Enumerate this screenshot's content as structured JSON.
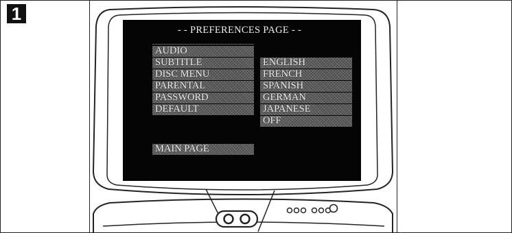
{
  "step": {
    "number": "1"
  },
  "screen": {
    "title": "- - PREFERENCES PAGE - -",
    "menu_items": [
      "AUDIO",
      "SUBTITLE",
      "DISC MENU",
      "PARENTAL",
      "PASSWORD",
      "DEFAULT"
    ],
    "options": [
      "ENGLISH",
      "FRENCH",
      "SPANISH",
      "GERMAN",
      "JAPANESE",
      "OFF"
    ],
    "main_page_label": "MAIN PAGE"
  },
  "colors": {
    "screen_background": "#050505",
    "menu_highlight": "#5a5a5a",
    "text": "#f2f2f2",
    "line_art": "#222222"
  },
  "icons": [
    "eye-logo-icon",
    "indicator-light-icon"
  ]
}
